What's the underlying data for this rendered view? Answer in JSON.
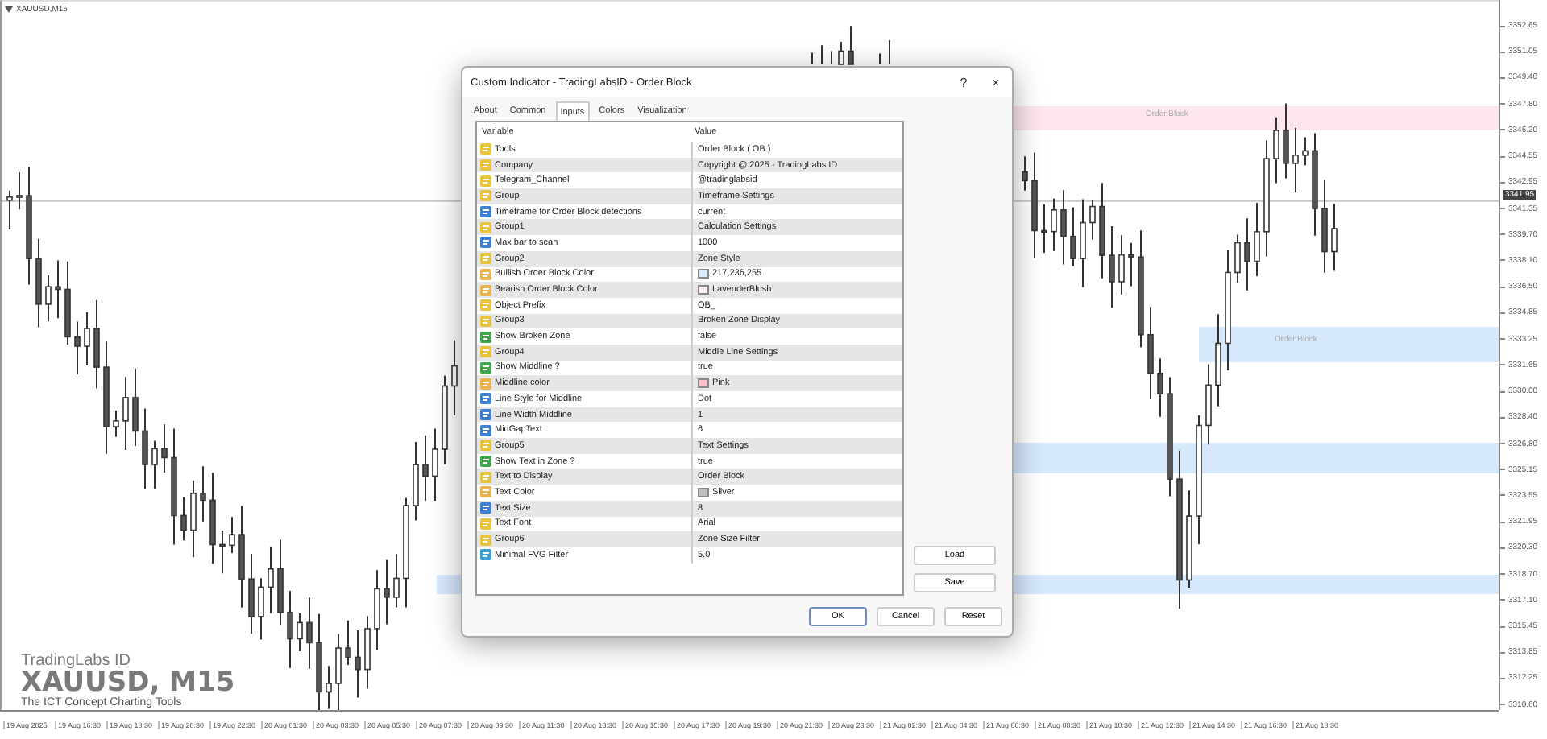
{
  "chart": {
    "symbol": "XAUUSD,M15",
    "price_labels": [
      "3352.65",
      "3351.05",
      "3349.40",
      "3347.80",
      "3346.20",
      "3344.55",
      "3342.95",
      "3341.35",
      "3339.70",
      "3338.10",
      "3336.50",
      "3334.85",
      "3333.25",
      "3331.65",
      "3330.00",
      "3328.40",
      "3326.80",
      "3325.15",
      "3323.55",
      "3321.95",
      "3320.30",
      "3318.70",
      "3317.10",
      "3315.45",
      "3313.85",
      "3312.25",
      "3310.60"
    ],
    "current_price": "3341.95",
    "time_labels": [
      "19 Aug 2025",
      "19 Aug 16:30",
      "19 Aug 18:30",
      "19 Aug 20:30",
      "19 Aug 22:30",
      "20 Aug 01:30",
      "20 Aug 03:30",
      "20 Aug 05:30",
      "20 Aug 07:30",
      "20 Aug 09:30",
      "20 Aug 11:30",
      "20 Aug 13:30",
      "20 Aug 15:30",
      "20 Aug 17:30",
      "20 Aug 19:30",
      "20 Aug 21:30",
      "20 Aug 23:30",
      "21 Aug 02:30",
      "21 Aug 04:30",
      "21 Aug 06:30",
      "21 Aug 08:30",
      "21 Aug 10:30",
      "21 Aug 12:30",
      "21 Aug 14:30",
      "21 Aug 16:30",
      "21 Aug 18:30"
    ],
    "zones": [
      {
        "color": "#fde6ee",
        "label": "Order Block"
      },
      {
        "color": "#d6e8fc",
        "label": "Order Block"
      },
      {
        "color": "#d6e8fc"
      },
      {
        "color": "#d6e8fc"
      }
    ],
    "branding": {
      "brand": "TradingLabs ID",
      "symbol": "XAUUSD, M15",
      "tagline": "The ICT Concept Charting Tools"
    }
  },
  "dialog": {
    "title": "Custom Indicator - TradingLabsID - Order Block",
    "help": "?",
    "close": "×",
    "tabs": [
      {
        "label": "About",
        "selected": false
      },
      {
        "label": "Common",
        "selected": false
      },
      {
        "label": "Inputs",
        "selected": true
      },
      {
        "label": "Colors",
        "selected": false
      },
      {
        "label": "Visualization",
        "selected": false
      }
    ],
    "columns": [
      "Variable",
      "Value"
    ],
    "rows": [
      {
        "kind": "string",
        "variable": "Tools",
        "value": "Order Block ( OB )"
      },
      {
        "kind": "string",
        "variable": "Company",
        "value": "Copyright @ 2025 - TradingLabs ID"
      },
      {
        "kind": "string",
        "variable": "Telegram_Channel",
        "value": "@tradinglabsid"
      },
      {
        "kind": "string",
        "variable": "Group",
        "value": "Timeframe Settings"
      },
      {
        "kind": "int",
        "variable": "Timeframe for Order Block detections",
        "value": "current"
      },
      {
        "kind": "string",
        "variable": "Group1",
        "value": "Calculation Settings"
      },
      {
        "kind": "int",
        "variable": "Max bar to scan",
        "value": "1000"
      },
      {
        "kind": "string",
        "variable": "Group2",
        "value": "Zone Style"
      },
      {
        "kind": "color",
        "variable": "Bullish Order Block Color",
        "value": "217,236,255",
        "color": "#d9ecff"
      },
      {
        "kind": "color",
        "variable": "Bearish Order Block Color",
        "value": "LavenderBlush",
        "color": "#fff0f5"
      },
      {
        "kind": "string",
        "variable": "Object Prefix",
        "value": "OB_"
      },
      {
        "kind": "string",
        "variable": "Group3",
        "value": "Broken Zone Display"
      },
      {
        "kind": "bool",
        "variable": "Show Broken Zone",
        "value": "false"
      },
      {
        "kind": "string",
        "variable": "Group4",
        "value": "Middle Line Settings"
      },
      {
        "kind": "bool",
        "variable": "Show Middline ?",
        "value": "true"
      },
      {
        "kind": "color",
        "variable": "Middline color",
        "value": "Pink",
        "color": "#ffc0cb"
      },
      {
        "kind": "int",
        "variable": "Line Style for Middline",
        "value": "Dot"
      },
      {
        "kind": "int",
        "variable": "Line Width Middline",
        "value": "1"
      },
      {
        "kind": "int",
        "variable": "MidGapText",
        "value": "6"
      },
      {
        "kind": "string",
        "variable": "Group5",
        "value": "Text Settings"
      },
      {
        "kind": "bool",
        "variable": "Show Text in Zone ?",
        "value": "true"
      },
      {
        "kind": "string",
        "variable": "Text to Display",
        "value": "Order Block"
      },
      {
        "kind": "color",
        "variable": "Text Color",
        "value": "Silver",
        "color": "#c0c0c0"
      },
      {
        "kind": "int",
        "variable": "Text Size",
        "value": "8"
      },
      {
        "kind": "string",
        "variable": "Text Font",
        "value": "Arial"
      },
      {
        "kind": "string",
        "variable": "Group6",
        "value": "Zone Size Filter"
      },
      {
        "kind": "double",
        "variable": "Minimal FVG Filter",
        "value": "5.0"
      }
    ],
    "side_buttons": [
      "Load",
      "Save"
    ],
    "buttons": [
      "OK",
      "Cancel",
      "Reset"
    ]
  }
}
